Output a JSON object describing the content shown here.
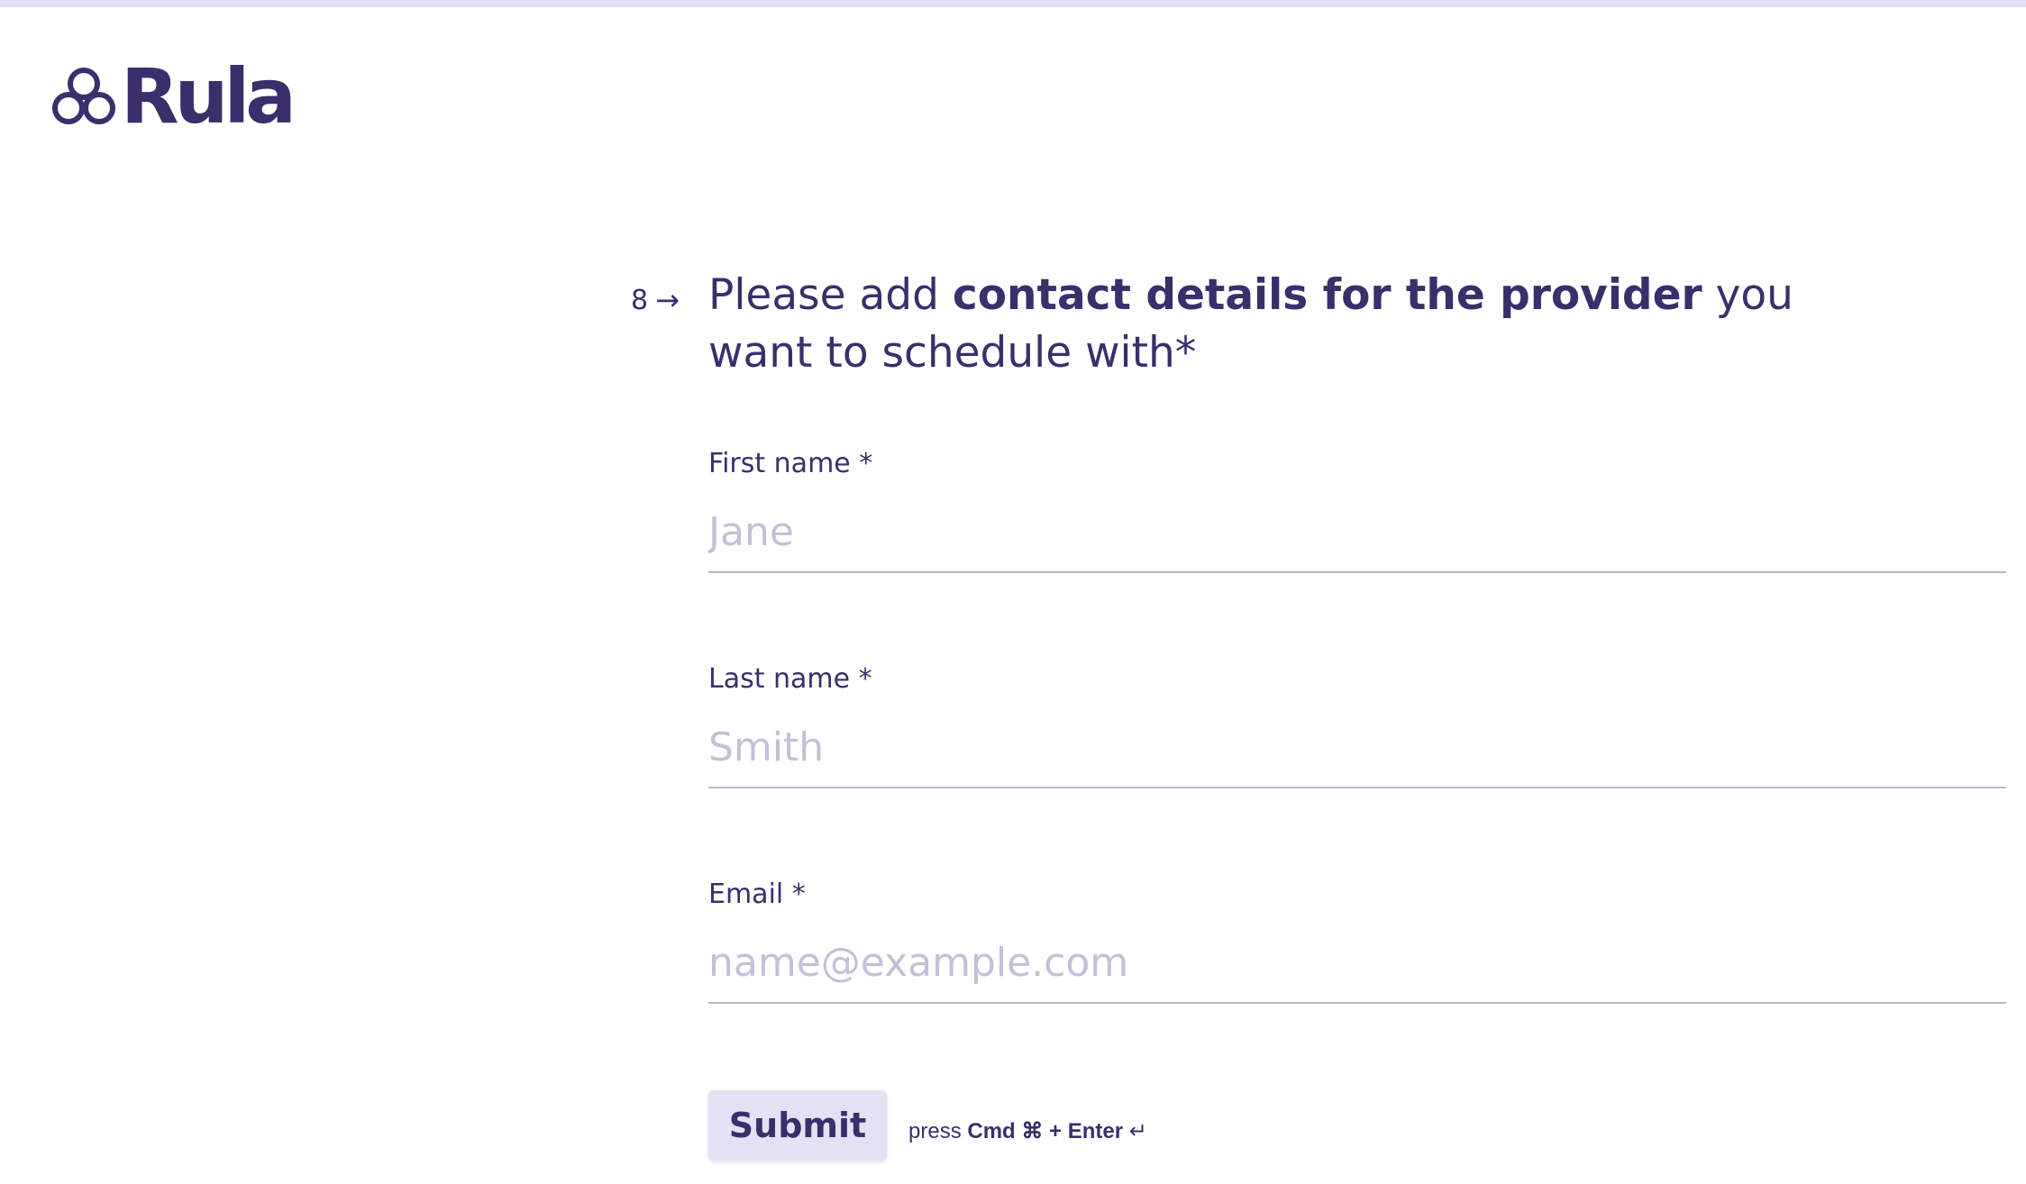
{
  "brand": {
    "name": "Rula",
    "color": "#3a2f6b"
  },
  "question": {
    "number": "8",
    "arrow_icon": "→",
    "text_before": "Please add ",
    "text_bold": "contact details for the provider",
    "text_after": " you want to schedule with*"
  },
  "fields": {
    "first_name": {
      "label": "First name *",
      "placeholder": "Jane",
      "value": ""
    },
    "last_name": {
      "label": "Last name *",
      "placeholder": "Smith",
      "value": ""
    },
    "email": {
      "label": "Email *",
      "placeholder": "name@example.com",
      "value": ""
    }
  },
  "submit": {
    "label": "Submit",
    "hint_prefix": "press",
    "hint_keys": "Cmd ⌘ + Enter",
    "hint_icon": "↵"
  }
}
